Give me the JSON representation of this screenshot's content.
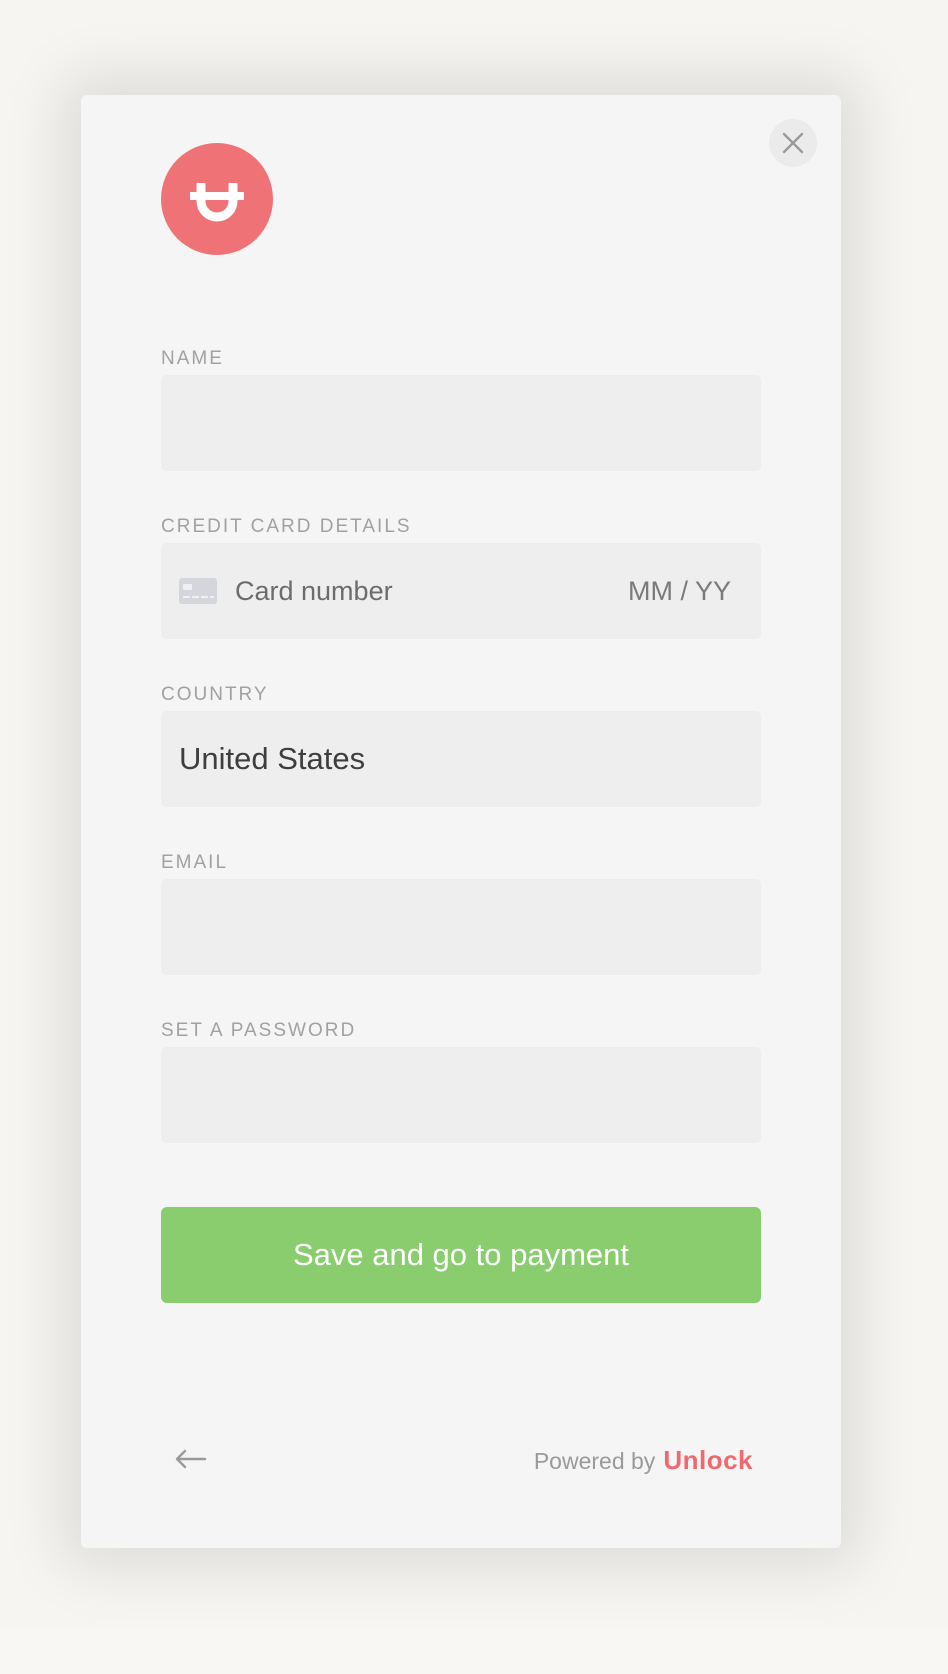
{
  "brand": {
    "logo_icon": "unlock-u-icon",
    "color": "#ef7376"
  },
  "form": {
    "name": {
      "label": "NAME",
      "value": ""
    },
    "card": {
      "label": "CREDIT CARD DETAILS",
      "icon": "credit-card-icon",
      "number_placeholder": "Card number",
      "expiry_placeholder": "MM / YY"
    },
    "country": {
      "label": "COUNTRY",
      "value": "United States"
    },
    "email": {
      "label": "EMAIL",
      "value": ""
    },
    "password": {
      "label": "SET A PASSWORD",
      "value": ""
    }
  },
  "actions": {
    "submit_label": "Save and go to payment",
    "submit_color": "#8acd6f",
    "close_icon": "close-icon",
    "back_icon": "arrow-left-icon"
  },
  "footer": {
    "powered_by": "Powered by",
    "brand_name": "Unlock"
  }
}
